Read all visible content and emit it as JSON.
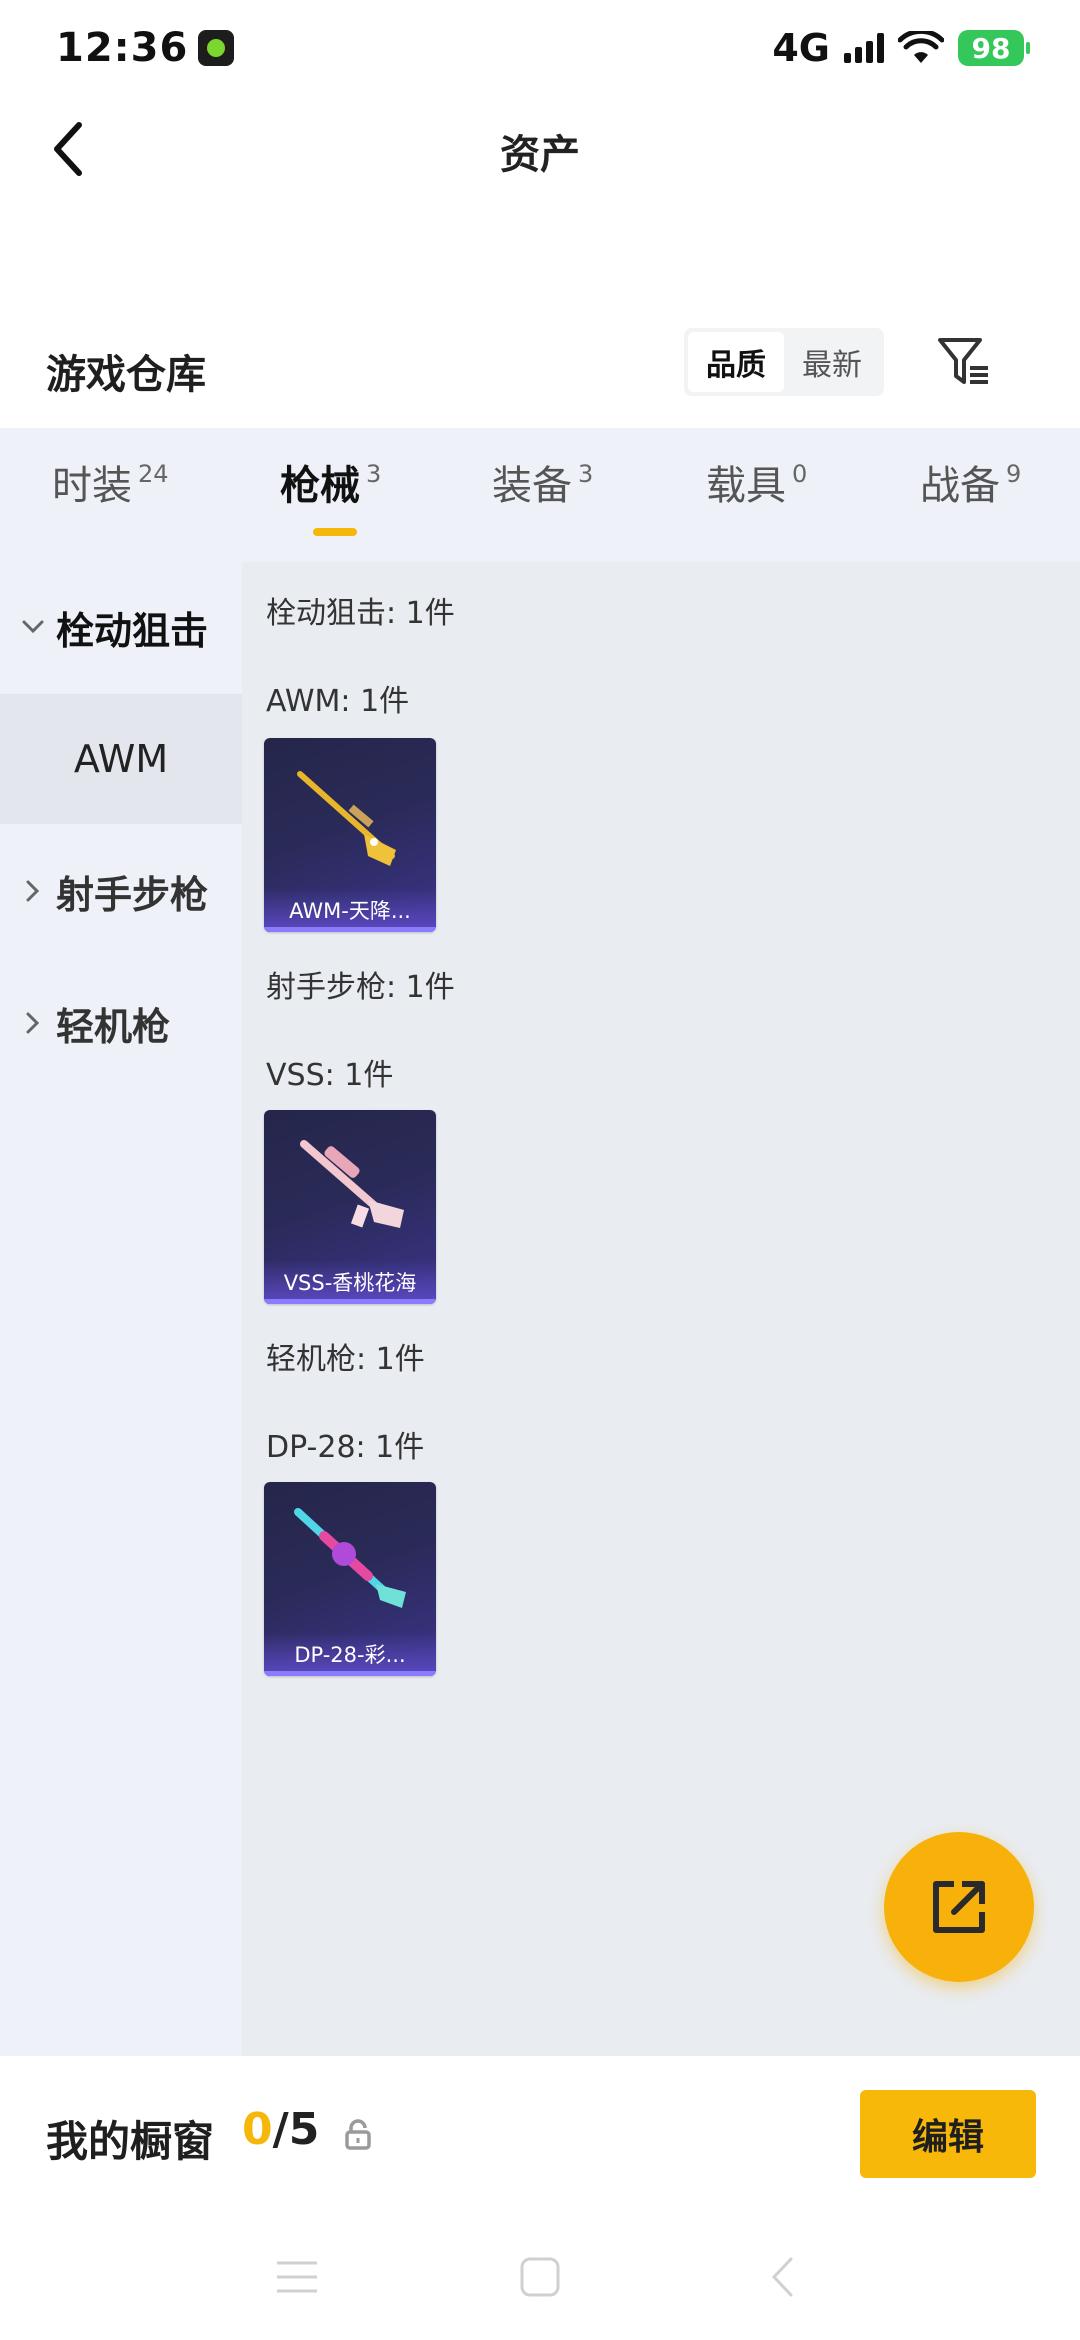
{
  "status_bar": {
    "time": "12:36",
    "network": "4G",
    "battery": "98",
    "colors": {
      "battery": "#34c759"
    }
  },
  "nav": {
    "title": "资产",
    "back_icon": "chevron-left-icon"
  },
  "warehouse": {
    "title": "游戏仓库",
    "sort_options": [
      "品质",
      "最新"
    ],
    "sort_selected": "品质",
    "filter_icon": "filter-list-icon"
  },
  "tabs": [
    {
      "label": "时装",
      "count": "24",
      "active": false
    },
    {
      "label": "枪械",
      "count": "3",
      "active": true
    },
    {
      "label": "装备",
      "count": "3",
      "active": false
    },
    {
      "label": "载具",
      "count": "0",
      "active": false
    },
    {
      "label": "战备",
      "count": "9",
      "active": false
    }
  ],
  "sidebar": {
    "items": [
      {
        "label": "栓动狙击",
        "expanded": true
      },
      {
        "label": "AWM",
        "selected": true
      },
      {
        "label": "射手步枪",
        "expanded": false
      },
      {
        "label": "轻机枪",
        "expanded": false
      }
    ]
  },
  "content": {
    "groups": [
      {
        "category": "栓动狙击: 1件",
        "subcategory": "AWM: 1件",
        "item_name": "AWM-天降...",
        "art": "gold-sniper-rifle"
      },
      {
        "category": "射手步枪: 1件",
        "subcategory": "VSS: 1件",
        "item_name": "VSS-香桃花海",
        "art": "pink-rifle"
      },
      {
        "category": "轻机枪: 1件",
        "subcategory": "DP-28: 1件",
        "item_name": "DP-28-彩...",
        "art": "rainbow-machine-gun"
      }
    ]
  },
  "fab": {
    "icon": "share-external-icon",
    "color": "#f7b10a"
  },
  "showcase": {
    "label": "我的橱窗",
    "used": "0",
    "total": "/5",
    "lock_icon": "lock-icon",
    "edit_label": "编辑",
    "accent": "#f5b80a"
  },
  "system_nav": {
    "icons": [
      "menu-icon",
      "home-icon",
      "back-icon"
    ]
  }
}
